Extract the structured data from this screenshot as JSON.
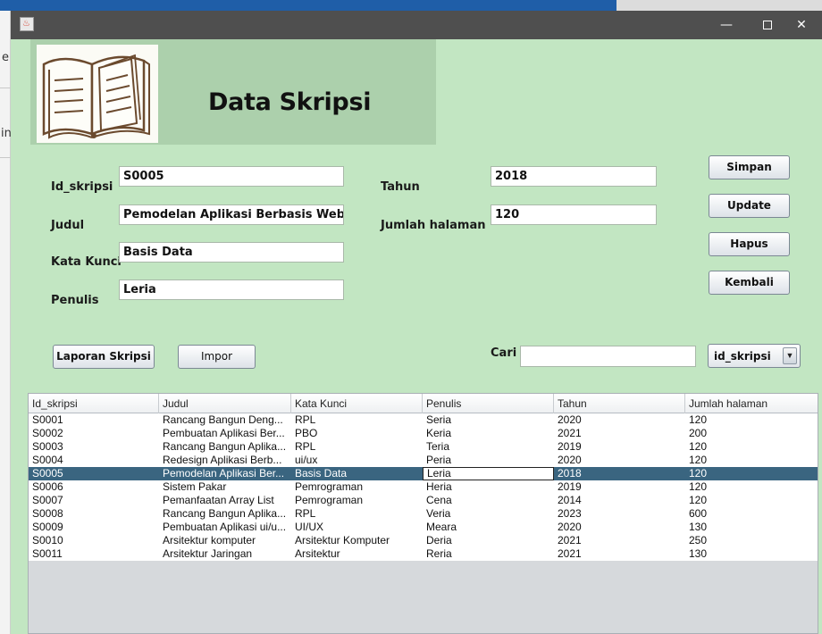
{
  "background": {
    "left_text_1": "e",
    "left_text_2": "in"
  },
  "window": {
    "icon": "java-app-icon",
    "controls": {
      "minimize": "—",
      "maximize": "☐",
      "close": "✕"
    }
  },
  "header": {
    "title": "Data Skripsi",
    "logo": "open-book-icon"
  },
  "form": {
    "id_label": "Id_skripsi",
    "id_value": "S0005",
    "judul_label": "Judul",
    "judul_value": "Pemodelan Aplikasi Berbasis Web",
    "kata_kunci_label": "Kata Kunci",
    "kata_kunci_value": "Basis Data",
    "penulis_label": "Penulis",
    "penulis_value": "Leria",
    "tahun_label": "Tahun",
    "tahun_value": "2018",
    "jumlah_label": "Jumlah halaman",
    "jumlah_value": "120"
  },
  "buttons": {
    "simpan": "Simpan",
    "update": "Update",
    "hapus": "Hapus",
    "kembali": "Kembali",
    "laporan": "Laporan Skripsi",
    "impor": "Impor"
  },
  "search": {
    "label": "Cari",
    "value": "",
    "combo_value": "id_skripsi"
  },
  "table": {
    "columns": [
      "Id_skripsi",
      "Judul",
      "Kata Kunci",
      "Penulis",
      "Tahun",
      "Jumlah halaman"
    ],
    "selected_row": 4,
    "rows": [
      [
        "S0001",
        "Rancang Bangun Deng...",
        "RPL",
        "Seria",
        "2020",
        "120"
      ],
      [
        "S0002",
        "Pembuatan Aplikasi Ber...",
        "PBO",
        "Keria",
        "2021",
        "200"
      ],
      [
        "S0003",
        "Rancang Bangun Aplika...",
        "RPL",
        "Teria",
        "2019",
        "120"
      ],
      [
        "S0004",
        "Redesign Aplikasi Berb...",
        "ui/ux",
        "Peria",
        "2020",
        "120"
      ],
      [
        "S0005",
        "Pemodelan Aplikasi Ber...",
        "Basis Data",
        "Leria",
        "2018",
        "120"
      ],
      [
        "S0006",
        "Sistem Pakar",
        "Pemrograman",
        "Heria",
        "2019",
        "120"
      ],
      [
        "S0007",
        "Pemanfaatan Array List",
        "Pemrograman",
        "Cena",
        "2014",
        "120"
      ],
      [
        "S0008",
        "Rancang Bangun Aplika...",
        "RPL",
        "Veria",
        "2023",
        "600"
      ],
      [
        "S0009",
        "Pembuatan Aplikasi ui/u...",
        "UI/UX",
        "Meara",
        "2020",
        "130"
      ],
      [
        "S0010",
        "Arsitektur komputer",
        "Arsitektur Komputer",
        "Deria",
        "2021",
        "250"
      ],
      [
        "S0011",
        "Arsitektur Jaringan",
        "Arsitektur",
        "Reria",
        "2021",
        "130"
      ]
    ]
  }
}
